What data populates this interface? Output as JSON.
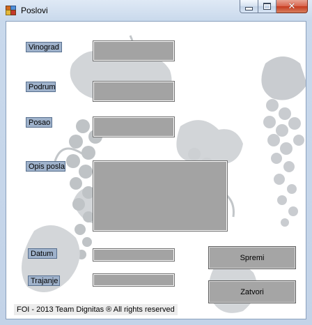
{
  "window": {
    "title": "Poslovi"
  },
  "titlebar_icons": {
    "app": "app-icon",
    "minimize": "minimize-icon",
    "maximize": "maximize-icon",
    "close": "close-icon"
  },
  "form": {
    "labels": {
      "vinograd": "Vinograd",
      "podrum": "Podrum",
      "posao": "Posao",
      "opis_posla": "Opis posla",
      "datum": "Datum",
      "trajanje": "Trajanje"
    },
    "fields": {
      "vinograd": "",
      "podrum": "",
      "posao": "",
      "opis_posla": "",
      "datum": "",
      "trajanje": ""
    }
  },
  "buttons": {
    "spremi": "Spremi",
    "zatvori": "Zatvori"
  },
  "footer": {
    "text": "FOI - 2013 Team Dignitas  ® All rights reserved"
  }
}
